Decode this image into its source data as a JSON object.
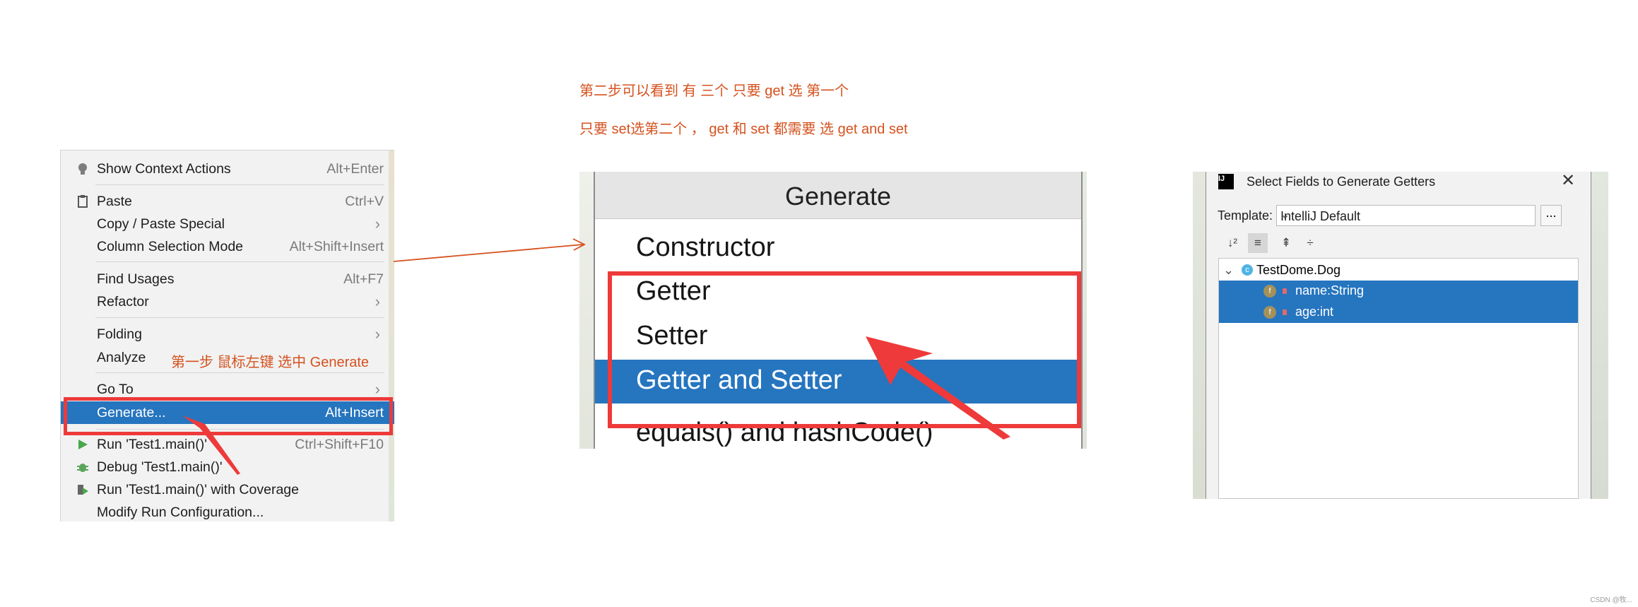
{
  "annotations": {
    "step1": "第一步 鼠标左键  选中 Generate",
    "step2_line1": "第二步可以看到  有 三个  只要 get  选 第一个",
    "step2_line2": "只要 set选第二个     ，   get  和 set  都需要 选  get and set"
  },
  "context_menu": {
    "items": [
      {
        "label": "Show Context Actions",
        "shortcut": "Alt+Enter",
        "icon": "lightbulb-icon"
      },
      {
        "label": "Paste",
        "shortcut": "Ctrl+V",
        "icon": "clipboard-icon"
      },
      {
        "label": "Copy / Paste Special",
        "submenu": "›"
      },
      {
        "label": "Column Selection Mode",
        "shortcut": "Alt+Shift+Insert"
      },
      {
        "label": "Find Usages",
        "shortcut": "Alt+F7"
      },
      {
        "label": "Refactor",
        "submenu": "›"
      },
      {
        "label": "Folding",
        "submenu": "›"
      },
      {
        "label": "Analyze",
        "submenu": "›"
      },
      {
        "label": "Go To",
        "submenu": "›"
      },
      {
        "label": "Generate...",
        "shortcut": "Alt+Insert",
        "selected": true
      },
      {
        "label": "Run 'Test1.main()'",
        "shortcut": "Ctrl+Shift+F10",
        "icon": "run-icon"
      },
      {
        "label": "Debug 'Test1.main()'",
        "icon": "debug-icon"
      },
      {
        "label": "Run 'Test1.main()' with Coverage",
        "icon": "coverage-icon"
      },
      {
        "label": "Modify Run Configuration..."
      }
    ]
  },
  "generate_popup": {
    "title": "Generate",
    "items": [
      "Constructor",
      "Getter",
      "Setter",
      "Getter and Setter",
      "equals() and hashCode()"
    ],
    "selected": "Getter and Setter"
  },
  "dialog": {
    "title": "Select Fields to Generate Getters",
    "close": "✕",
    "template_label": "Template:",
    "template_value": "IntelliJ Default",
    "more_button": "...",
    "tree": {
      "class": "TestDome.Dog",
      "fields": [
        "name:String",
        "age:int"
      ]
    }
  },
  "colors": {
    "annotation": "#d5521f",
    "highlight_box": "#ee3a3a",
    "selection": "#2675bf"
  },
  "watermark": "CSDN @牧..."
}
